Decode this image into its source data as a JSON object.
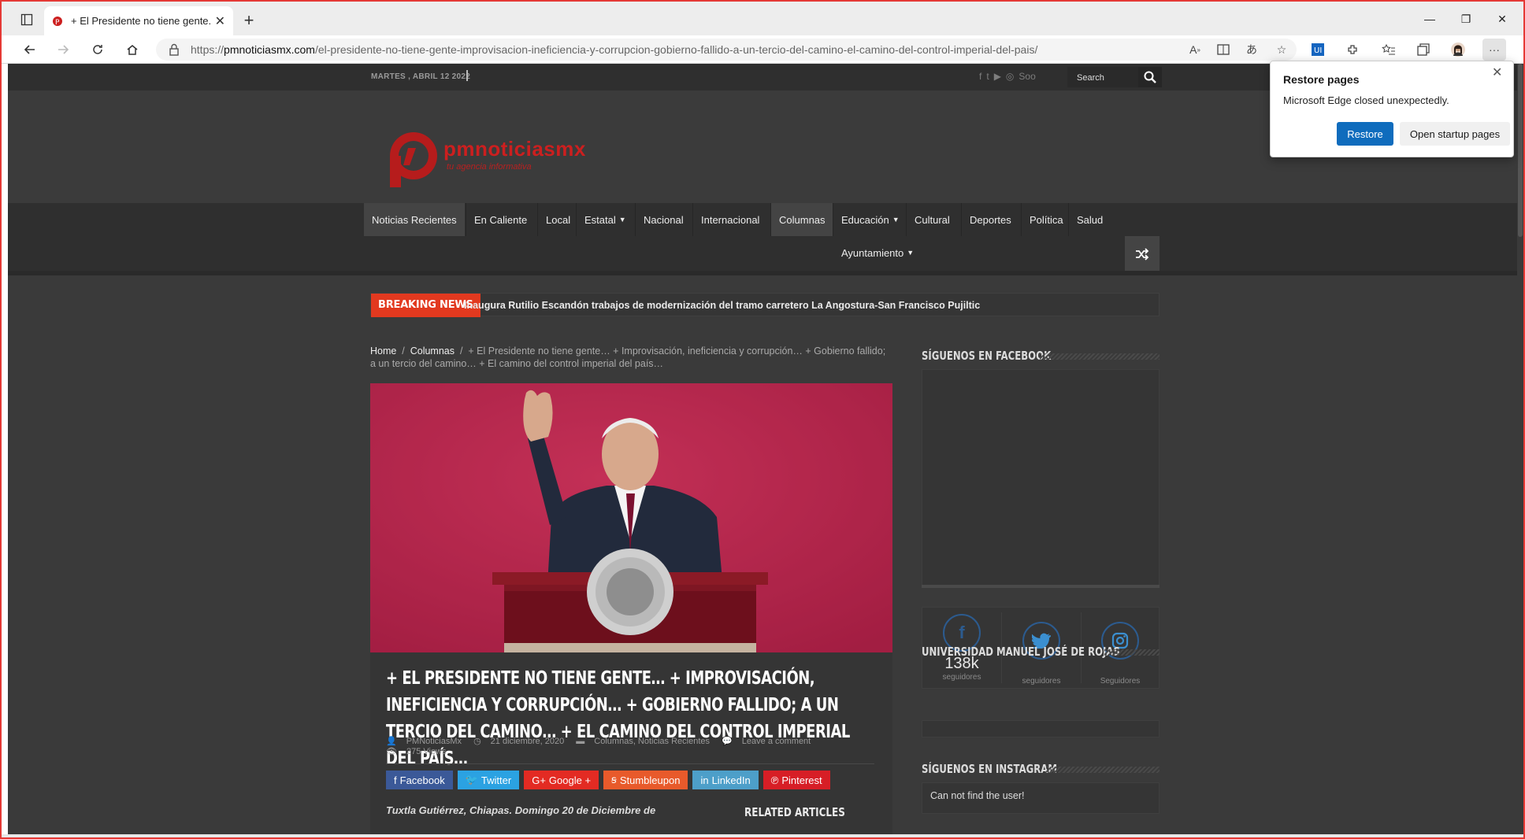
{
  "browser": {
    "tab_title": "+ El Presidente no tiene gente...",
    "url_scheme": "https://",
    "url_domain": "pmnoticiasmx.com",
    "url_path": "/el-presidente-no-tiene-gente-improvisacion-ineficiencia-y-corrupcion-gobierno-fallido-a-un-tercio-del-camino-el-camino-del-control-imperial-del-pais/",
    "read_aloud_label": "A̓",
    "translate_label": "â"
  },
  "popup": {
    "title": "Restore pages",
    "message": "Microsoft Edge closed unexpectedly.",
    "restore_label": "Restore",
    "startup_label": "Open startup pages"
  },
  "site": {
    "date": "MARTES , ABRIL 12 2022",
    "search_placeholder": "Search",
    "soo": "Soo",
    "logo_name": "pmnoticiasmx",
    "logo_tagline": "tu agencia informativa",
    "nav": [
      {
        "label": "Noticias Recientes"
      },
      {
        "label": "En Caliente"
      },
      {
        "label": "Local"
      },
      {
        "label": "Estatal"
      },
      {
        "label": "Nacional"
      },
      {
        "label": "Internacional"
      },
      {
        "label": "Columnas"
      },
      {
        "label": "Educación"
      },
      {
        "label": "Cultural"
      },
      {
        "label": "Deportes"
      },
      {
        "label": "Política"
      },
      {
        "label": "Salud"
      },
      {
        "label": "Ayuntamiento"
      }
    ],
    "breaking_label": "BREAKING NEWS",
    "breaking_text": "Inaugura Rutilio Escandón trabajos de modernización del tramo carretero La Angostura-San Francisco Pujiltic"
  },
  "article": {
    "crumb_home": "Home",
    "crumb_section": "Columnas",
    "crumb_current": "+ El Presidente no tiene gente… + Improvisación, ineficiencia y corrupción… + Gobierno fallido; a un tercio del camino… + El camino del control imperial del país…",
    "title": "+ EL PRESIDENTE NO TIENE GENTE… + IMPROVISACIÓN, INEFICIENCIA Y CORRUPCIÓN… + GOBIERNO FALLIDO; A UN TERCIO DEL CAMINO… + EL CAMINO DEL CONTROL IMPERIAL DEL PAÍS…",
    "author": "PMNoticiasMx",
    "date": "21 diciembre, 2020",
    "categories": "Columnas, Noticias Recientes",
    "comment": "Leave a comment",
    "views": "275 Views",
    "share": {
      "facebook": "Facebook",
      "twitter": "Twitter",
      "google": "Google +",
      "stumbleupon": "Stumbleupon",
      "linkedin": "LinkedIn",
      "pinterest": "Pinterest"
    },
    "lead": "Tuxtla Gutiérrez, Chiapas. Domingo 20 de Diciembre de",
    "related_title": "RELATED ARTICLES"
  },
  "sidebar": {
    "facebook_title": "SÍGUENOS EN FACEBOOK",
    "counter_facebook_num": "138k",
    "counter_facebook_lbl": "seguidores",
    "counter_twitter_lbl": "seguidores",
    "counter_instagram_lbl": "Seguidores",
    "university_title": "UNIVERSIDAD MANUEL JOSÉ DE ROJAS",
    "instagram_title": "SÍGUENOS EN INSTAGRAM",
    "instagram_error": "Can not find the user!"
  },
  "colors": {
    "breaking": "#e2391f",
    "facebook": "#3b5998",
    "twitter": "#2ba2e2",
    "google": "#e32b23",
    "stumbleupon": "#e85a2b",
    "linkedin": "#4d9fc9",
    "pinterest": "#d71e26",
    "edge_blue": "#0f6cbd"
  }
}
